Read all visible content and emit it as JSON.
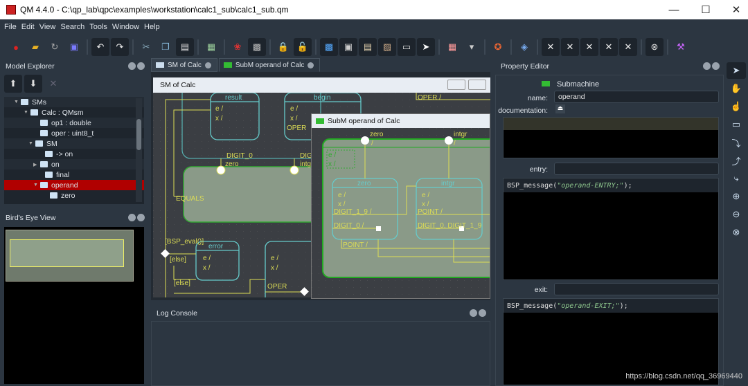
{
  "window": {
    "title": "QM 4.4.0 - C:\\qp_lab\\qpc\\examples\\workstation\\calc1_sub\\calc1_sub.qm",
    "min": "—",
    "max": "☐",
    "close": "✕"
  },
  "menu": [
    "File",
    "Edit",
    "View",
    "Search",
    "Tools",
    "Window",
    "Help"
  ],
  "toolbar": [
    {
      "icon": "new-model-icon",
      "g": "●",
      "c": "#d22"
    },
    {
      "icon": "open-folder-icon",
      "g": "▰",
      "c": "#e9b224"
    },
    {
      "icon": "reload-icon",
      "g": "↻",
      "c": "#aaa"
    },
    {
      "icon": "save-icon",
      "g": "▣",
      "c": "#7a7aff"
    },
    "|",
    {
      "icon": "undo-icon",
      "g": "↶",
      "c": "#eee",
      "dk": 1
    },
    {
      "icon": "redo-icon",
      "g": "↷",
      "c": "#eee",
      "dk": 1
    },
    "|",
    {
      "icon": "cut-icon",
      "g": "✂",
      "c": "#8ab"
    },
    {
      "icon": "copy-icon",
      "g": "❐",
      "c": "#8bd"
    },
    {
      "icon": "paste-icon",
      "g": "▤",
      "c": "#ddd",
      "dk": 1
    },
    "|",
    {
      "icon": "diagram-icon",
      "g": "▦",
      "c": "#9c9"
    },
    "|",
    {
      "icon": "generate-code-icon",
      "g": "❀",
      "c": "#d33"
    },
    {
      "icon": "print-icon",
      "g": "▩",
      "c": "#bbb",
      "dk": 1
    },
    "|",
    {
      "icon": "lock-icon",
      "g": "🔒",
      "c": "#f80"
    },
    {
      "icon": "unlock-icon",
      "g": "🔓",
      "c": "#fc0",
      "dk": 1
    },
    "|",
    {
      "icon": "export-icon",
      "g": "▩",
      "c": "#5af",
      "dk": 1
    },
    {
      "icon": "image-icon",
      "g": "▣",
      "c": "#ccc",
      "dk": 1
    },
    {
      "icon": "open-image-icon",
      "g": "▤",
      "c": "#dca",
      "dk": 1
    },
    {
      "icon": "edit-image-icon",
      "g": "▨",
      "c": "#ca8",
      "dk": 1
    },
    {
      "icon": "log-icon",
      "g": "▭",
      "c": "#ddd",
      "dk": 1
    },
    {
      "icon": "pointer-icon",
      "g": "➤",
      "c": "#fff",
      "dk": 1
    },
    "|",
    {
      "icon": "grid-icon",
      "g": "▦",
      "c": "#f99"
    },
    {
      "icon": "dropdown-arrow-icon",
      "g": "▾",
      "c": "#ccc"
    },
    "|",
    {
      "icon": "certificate-icon",
      "g": "✪",
      "c": "#e63"
    },
    "|",
    {
      "icon": "layers-icon",
      "g": "◈",
      "c": "#7ae"
    },
    "|",
    {
      "icon": "tools-icon",
      "g": "✕",
      "c": "#eee",
      "dk": 1
    },
    {
      "icon": "tools-icon",
      "g": "✕",
      "c": "#eee",
      "dk": 1
    },
    {
      "icon": "tools-icon",
      "g": "✕",
      "c": "#eee",
      "dk": 1
    },
    {
      "icon": "tools-icon",
      "g": "✕",
      "c": "#eee",
      "dk": 1
    },
    {
      "icon": "tools-icon",
      "g": "✕",
      "c": "#eee",
      "dk": 1
    },
    "|",
    {
      "icon": "stop-icon",
      "g": "⊗",
      "c": "#ddd",
      "dk": 1
    },
    "|",
    {
      "icon": "settings-icon",
      "g": "⚒",
      "c": "#c6f"
    }
  ],
  "model_explorer": {
    "title": "Model Explorer",
    "tree": [
      {
        "label": "SMs",
        "level": 0,
        "arrow": "▼"
      },
      {
        "label": "Calc : QMsm",
        "level": 1,
        "arrow": "▼"
      },
      {
        "label": "op1 : double",
        "level": 2,
        "arrow": ""
      },
      {
        "label": "oper : uint8_t",
        "level": 2,
        "arrow": ""
      },
      {
        "label": "SM",
        "level": 1.5,
        "arrow": "▼"
      },
      {
        "label": "-> on",
        "level": 2.5,
        "arrow": ""
      },
      {
        "label": "on",
        "level": 2,
        "arrow": "▶"
      },
      {
        "label": "final",
        "level": 2.5,
        "arrow": ""
      },
      {
        "label": "operand",
        "level": 2,
        "arrow": "▼",
        "selected": true
      },
      {
        "label": "zero",
        "level": 3,
        "arrow": ""
      }
    ]
  },
  "birds_eye": {
    "title": "Bird's Eye View"
  },
  "tabs": [
    {
      "label": "SM of Calc"
    },
    {
      "label": "SubM operand of Calc",
      "active": true
    }
  ],
  "sm_window": {
    "title": "SM of Calc",
    "states": {
      "result": "result",
      "begin": "begin",
      "error": "error"
    },
    "labels": {
      "ev": "e /",
      "xv": "x /",
      "oper": "OPER",
      "oper_top": "OPER /",
      "digit0": "DIGIT_0",
      "dig": "DIG",
      "zero": "zero",
      "intg": "intg",
      "equals": "EQUALS",
      "bsp_eval": "[BSP_eval()]",
      "else": "[else]"
    }
  },
  "subm_window": {
    "title": "SubM operand of Calc",
    "labels": {
      "zero": "zero",
      "intgr": "intgr",
      "slash": "/",
      "ev": "e /",
      "xv": "x /",
      "digit_1_9": "DIGIT_1_9 /",
      "digit_0": "DIGIT_0 /",
      "point": "POINT /",
      "digit_0_1_9": "DIGIT_0, DIGIT_1_9"
    }
  },
  "log_console": {
    "title": "Log Console"
  },
  "property_editor": {
    "title": "Property Editor",
    "type": "Submachine",
    "name_label": "name:",
    "name_value": "operand",
    "doc_label": "documentation:",
    "entry_label": "entry:",
    "entry_code_pre": "BSP_message(",
    "entry_code_str": "\"operand-ENTRY;\"",
    "entry_code_post": ");",
    "exit_label": "exit:",
    "exit_code_pre": "BSP_message(",
    "exit_code_str": "\"operand-EXIT;\"",
    "exit_code_post": ");"
  },
  "right_toolbar": [
    {
      "icon": "pointer-icon",
      "g": "➤"
    },
    {
      "icon": "hand-icon",
      "g": "✋"
    },
    {
      "icon": "hand-pointer-icon",
      "g": "☝"
    },
    {
      "icon": "state-icon",
      "g": "▭"
    },
    {
      "icon": "transition-icon",
      "g": "⤵"
    },
    {
      "icon": "choice-icon",
      "g": "⤴"
    },
    {
      "icon": "initial-transition-icon",
      "g": "⤷"
    },
    {
      "icon": "zoom-in-icon",
      "g": "⊕"
    },
    {
      "icon": "zoom-out-icon",
      "g": "⊖"
    },
    {
      "icon": "close-circle-icon",
      "g": "⊗"
    }
  ],
  "watermark": "https://blog.csdn.net/qq_36969440"
}
